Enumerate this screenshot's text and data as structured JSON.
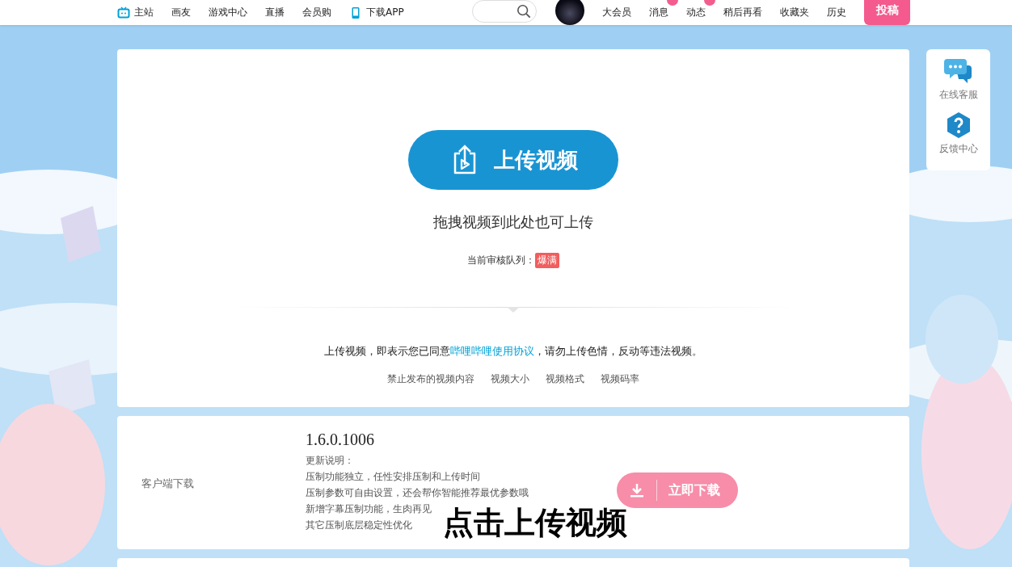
{
  "nav": {
    "items": [
      {
        "label": "主站",
        "kind": "tv"
      },
      {
        "label": "画友",
        "kind": "plain"
      },
      {
        "label": "游戏中心",
        "kind": "plain"
      },
      {
        "label": "直播",
        "kind": "plain"
      },
      {
        "label": "会员购",
        "kind": "plain"
      },
      {
        "label": "下载APP",
        "kind": "phone"
      }
    ],
    "right_items": [
      {
        "label": "大会员",
        "badge": false
      },
      {
        "label": "消息",
        "badge": true
      },
      {
        "label": "动态",
        "badge": true
      },
      {
        "label": "稍后再看",
        "badge": false
      },
      {
        "label": "收藏夹",
        "badge": false
      },
      {
        "label": "历史",
        "badge": false
      }
    ],
    "post_button": "投稿"
  },
  "upload": {
    "button": "上传视频",
    "drag_hint": "拖拽视频到此处也可上传",
    "queue_label": "当前审核队列：",
    "queue_status": "爆满",
    "agreement_before": "上传视频，即表示您已同意",
    "agreement_link": "哔哩哔哩使用协议",
    "agreement_after": "，请勿上传色情，反动等违法视频。",
    "links": [
      "禁止发布的视频内容",
      "视频大小",
      "视频格式",
      "视频码率"
    ]
  },
  "client": {
    "label": "客户端下载",
    "version": "1.6.0.1006",
    "notes_title": "更新说明：",
    "notes": [
      "压制功能独立，任性安排压制和上传时间",
      "压制参数可自由设置，还会帮你智能推荐最优参数哦",
      "新增字幕压制功能，生肉再见",
      "其它压制底层稳定性优化"
    ],
    "download_button": "立即下载"
  },
  "side_panel": [
    {
      "label": "在线客服",
      "kind": "chat"
    },
    {
      "label": "反馈中心",
      "kind": "help"
    }
  ],
  "caption": "点击上传视频"
}
